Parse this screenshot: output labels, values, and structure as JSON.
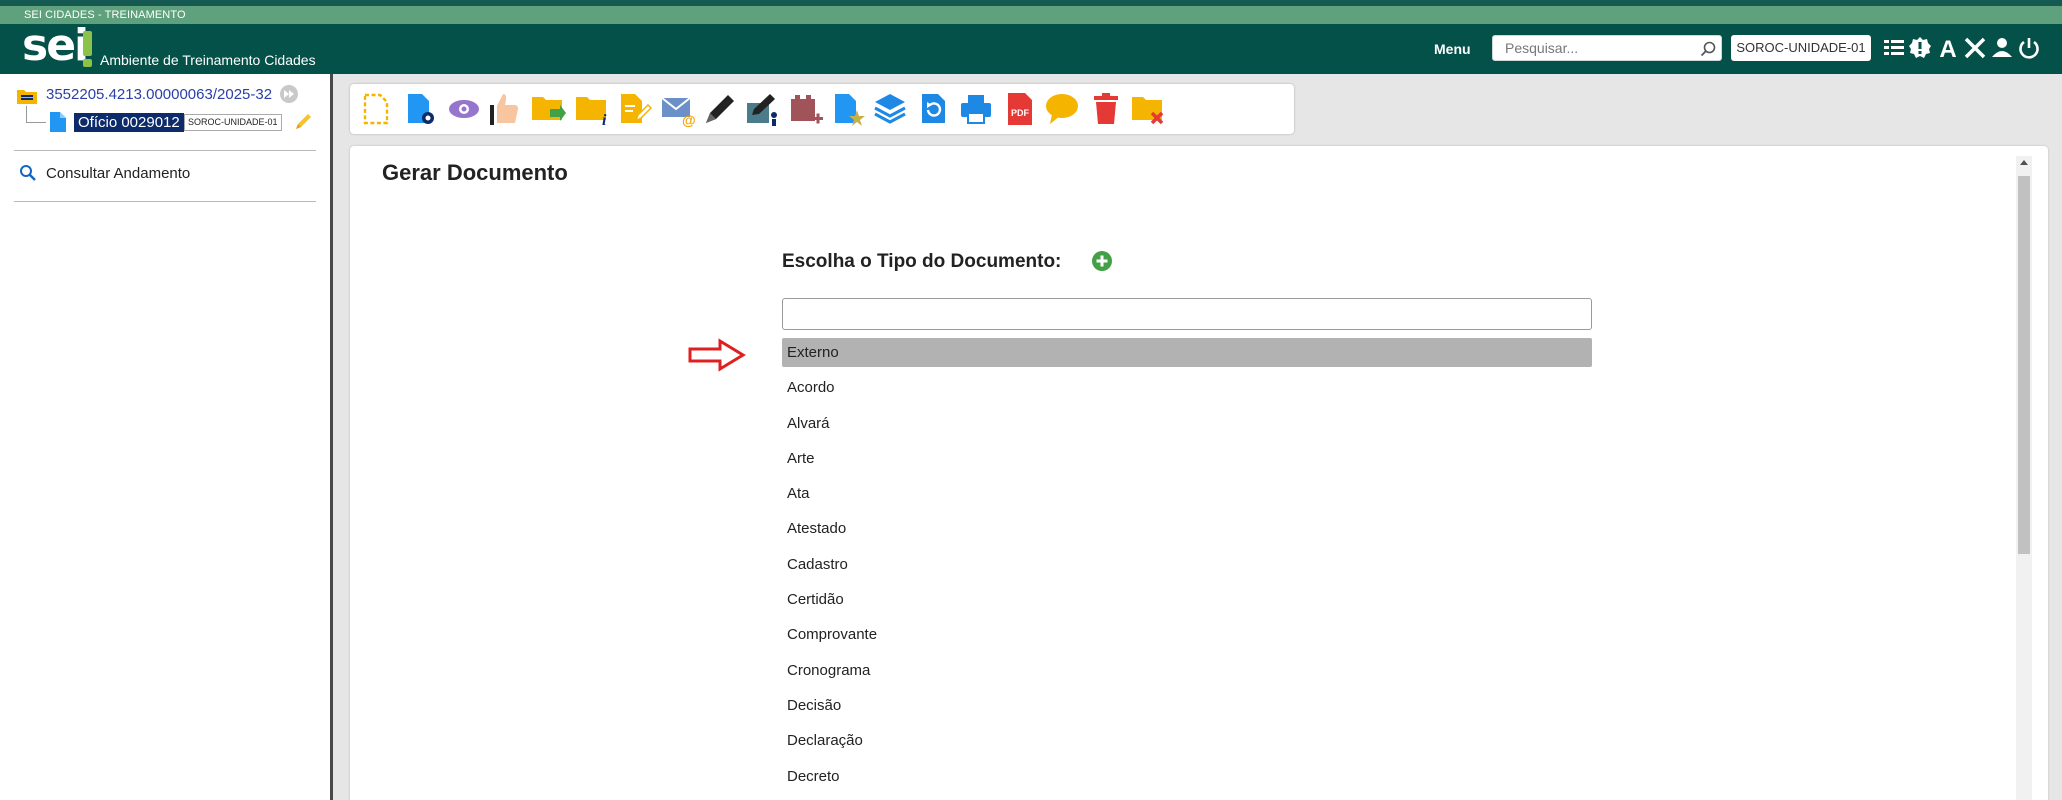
{
  "header": {
    "environment_label": "SEI CIDADES - TREINAMENTO",
    "logo_text": "sei",
    "app_subtitle": "Ambiente de Treinamento Cidades",
    "menu_label": "Menu",
    "search_placeholder": "Pesquisar...",
    "unit_button": "SOROC-UNIDADE-01",
    "icons": [
      "list-view-icon",
      "certificate-seal-icon",
      "accessibility-font-icon",
      "tools-icon",
      "user-icon",
      "power-icon"
    ]
  },
  "sidebar": {
    "process_number": "3552205.4213.00000063/2025-32",
    "document_label": "Ofício 0029012",
    "document_unit": "SOROC-UNIDADE-01",
    "consult_label": "Consultar Andamento"
  },
  "toolbar": {
    "icons": [
      "new-document-icon",
      "document-settings-icon",
      "eye-icon",
      "signature-icon",
      "send-process-icon",
      "process-info-icon",
      "edit-document-icon",
      "email-icon",
      "pen-icon",
      "assign-icon",
      "block-icon",
      "favorite-document-icon",
      "layers-icon",
      "reopen-icon",
      "print-icon",
      "pdf-icon",
      "comment-icon",
      "trash-icon",
      "close-process-icon"
    ]
  },
  "content": {
    "title": "Gerar Documento",
    "type_heading": "Escolha o Tipo do Documento:",
    "filter_value": "",
    "selected_index": 0,
    "document_types": [
      "Externo",
      "Acordo",
      "Alvará",
      "Arte",
      "Ata",
      "Atestado",
      "Cadastro",
      "Certidão",
      "Comprovante",
      "Cronograma",
      "Decisão",
      "Declaração",
      "Decreto"
    ]
  },
  "colors": {
    "header_bg": "#04514a",
    "env_bar_bg": "#5ea17c",
    "logo_accent": "#8bc34a",
    "doc_badge_bg": "#0d2b6b",
    "link_color": "#2a3fa8",
    "selected_item_bg": "#b2b2b2",
    "arrow_red": "#e02020"
  }
}
